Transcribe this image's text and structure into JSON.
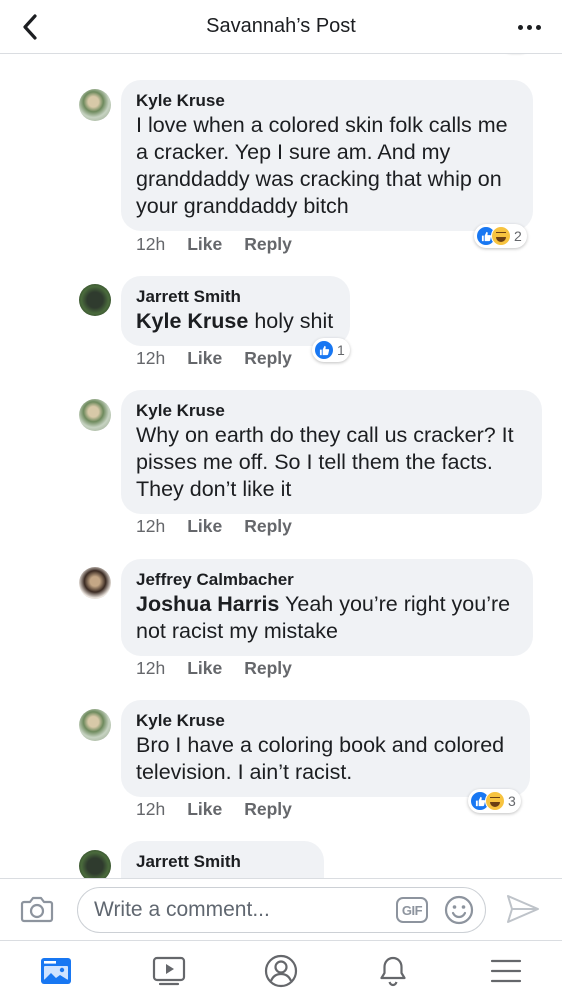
{
  "header": {
    "title": "Savannah’s Post"
  },
  "comments": [
    {
      "author": "Kyle Kruse",
      "text_lines": [
        "I love when a colored skin folk calls me",
        "a cracker. Yep I sure am. And my",
        "granddaddy was cracking that whip on",
        "your granddaddy bitch"
      ],
      "time": "12h",
      "like_label": "Like",
      "reply_label": "Reply",
      "reaction_count": "2",
      "reactions": [
        "like",
        "haha"
      ]
    },
    {
      "author": "Jarrett Smith",
      "mention": "Kyle Kruse",
      "text": " holy shit",
      "time": "12h",
      "like_label": "Like",
      "reply_label": "Reply",
      "reaction_count": "1",
      "reactions": [
        "like"
      ]
    },
    {
      "author": "Kyle Kruse",
      "text_lines": [
        "Why on earth do they call us cracker? It",
        "pisses me off. So I tell them the facts.",
        "They don’t like it"
      ],
      "time": "12h",
      "like_label": "Like",
      "reply_label": "Reply"
    },
    {
      "author": "Jeffrey Calmbacher",
      "mention": "Joshua Harris",
      "text": " Yeah you’re right you’re",
      "text_line2": "not racist my mistake",
      "time": "12h",
      "like_label": "Like",
      "reply_label": "Reply"
    },
    {
      "author": "Kyle Kruse",
      "text_lines": [
        "Bro I have a coloring book and colored",
        "television. I ain’t racist."
      ],
      "time": "12h",
      "like_label": "Like",
      "reply_label": "Reply",
      "reaction_count": "3",
      "reactions": [
        "like",
        "haha"
      ]
    },
    {
      "author": "Jarrett Smith"
    }
  ],
  "composer": {
    "placeholder": "Write a comment...",
    "gif_label": "GIF",
    "icons": [
      "camera-icon",
      "gif-icon",
      "emoji-icon",
      "send-icon"
    ]
  },
  "bottom_nav": {
    "items": [
      "news-feed-icon",
      "watch-icon",
      "profile-icon",
      "notifications-icon",
      "menu-icon"
    ],
    "active": "news-feed-icon",
    "colors": {
      "active": "#1877f2",
      "inactive": "#65676b"
    }
  }
}
